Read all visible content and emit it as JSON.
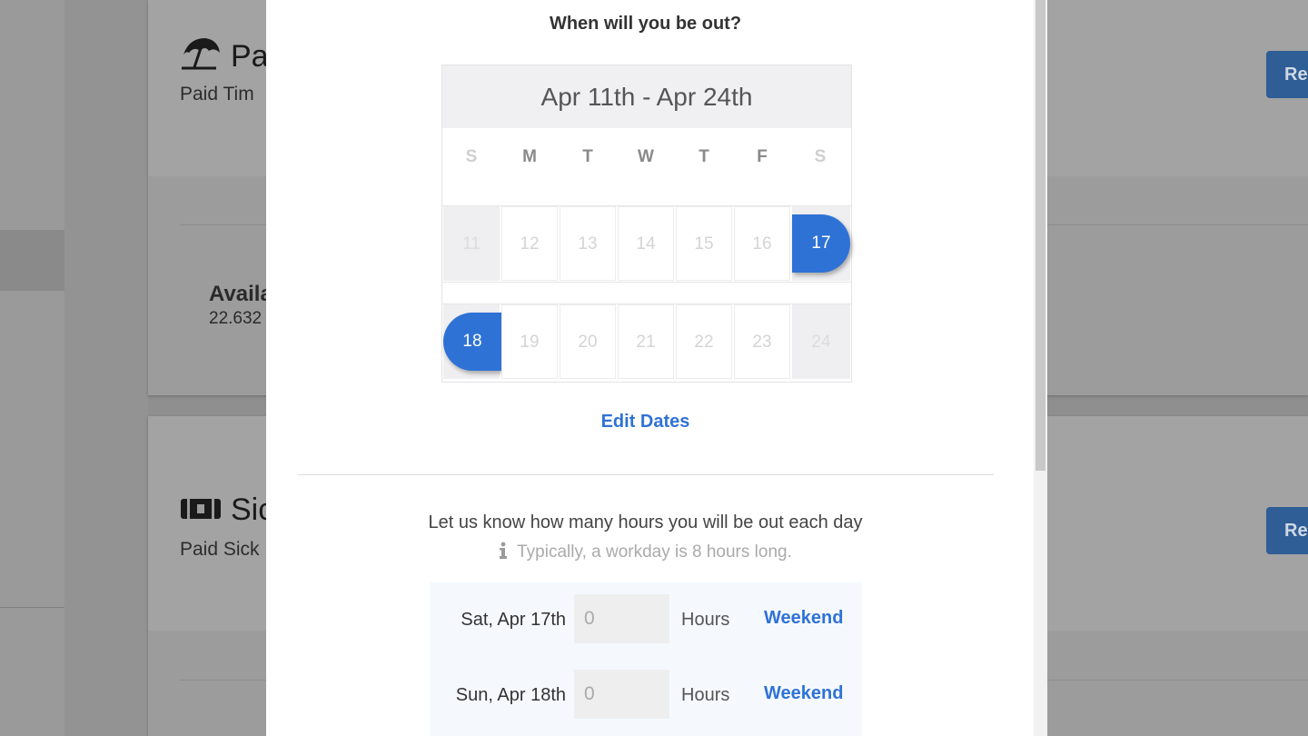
{
  "background": {
    "card1": {
      "title": "Pa",
      "subtitle": "Paid Tim",
      "available_label": "Availa",
      "available_value": "22.632",
      "button_label": "Re"
    },
    "card2": {
      "title": "Sic",
      "subtitle": "Paid Sick",
      "button_label": "Re"
    }
  },
  "modal": {
    "question": "When will you be out?",
    "calendar": {
      "range_label": "Apr 11th - Apr 24th",
      "weekdays": [
        "S",
        "M",
        "T",
        "W",
        "T",
        "F",
        "S"
      ],
      "week1": [
        "11",
        "12",
        "13",
        "14",
        "15",
        "16",
        "17"
      ],
      "week2": [
        "18",
        "19",
        "20",
        "21",
        "22",
        "23",
        "24"
      ],
      "selected_start": "17",
      "selected_end": "18"
    },
    "edit_dates": "Edit Dates",
    "hours_prompt": "Let us know how many hours you will be out each day",
    "hint": "Typically, a workday is 8 hours long.",
    "hint_icon": "info-icon",
    "rows": [
      {
        "date": "Sat, Apr 17th",
        "value": "0",
        "unit": "Hours",
        "tag": "Weekend"
      },
      {
        "date": "Sun, Apr 18th",
        "value": "0",
        "unit": "Hours",
        "tag": "Weekend"
      }
    ]
  },
  "colors": {
    "accent": "#2f72d6",
    "overlay": "#8f8f8f"
  }
}
